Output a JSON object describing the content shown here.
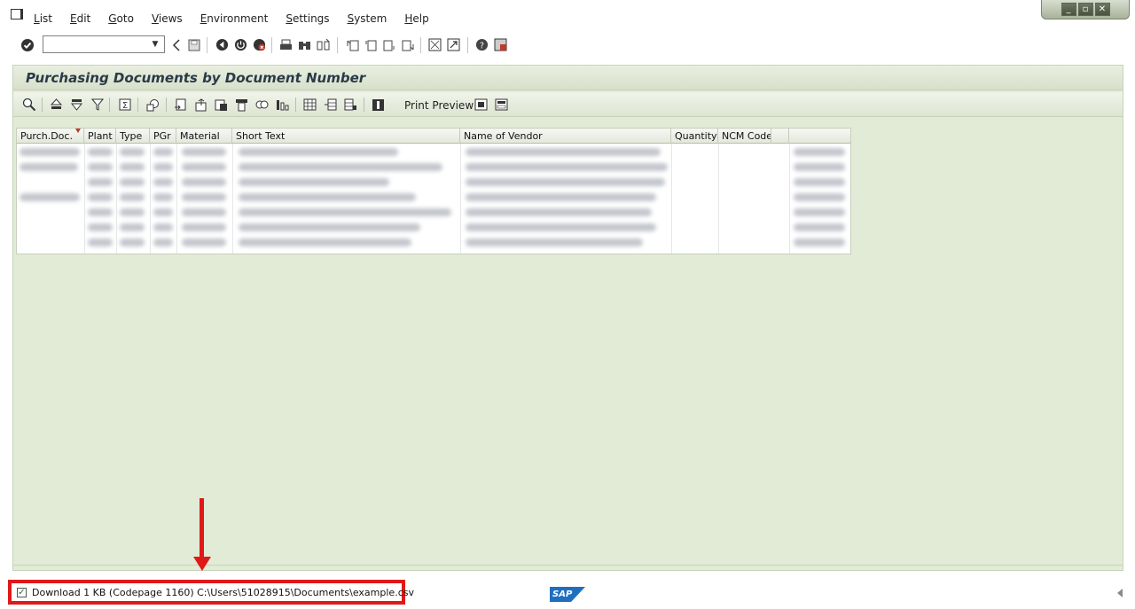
{
  "menu": {
    "items": [
      "List",
      "Edit",
      "Goto",
      "Views",
      "Environment",
      "Settings",
      "System",
      "Help"
    ]
  },
  "window_controls": {
    "minimize": "_",
    "restore": "▫",
    "close": "✕"
  },
  "command_field": {
    "value": ""
  },
  "page": {
    "title": "Purchasing Documents by Document Number"
  },
  "app_toolbar": {
    "print_preview_label": "Print Preview"
  },
  "grid": {
    "columns": [
      "Purch.Doc.",
      "Plant",
      "Type",
      "PGr",
      "Material",
      "Short Text",
      "Name of Vendor",
      "Quantity",
      "NCM Code"
    ],
    "sort_column": "Purch.Doc.",
    "row_count_visible": 7
  },
  "status": {
    "message": "Download 1 KB (Codepage 1160) C:\\Users\\51028915\\Documents\\example.csv",
    "type": "success"
  },
  "branding": {
    "logo_text": "SAP"
  },
  "colors": {
    "main_background": "#e2ebd5",
    "annotation": "#e01818",
    "title_text": "#2a3a48"
  }
}
